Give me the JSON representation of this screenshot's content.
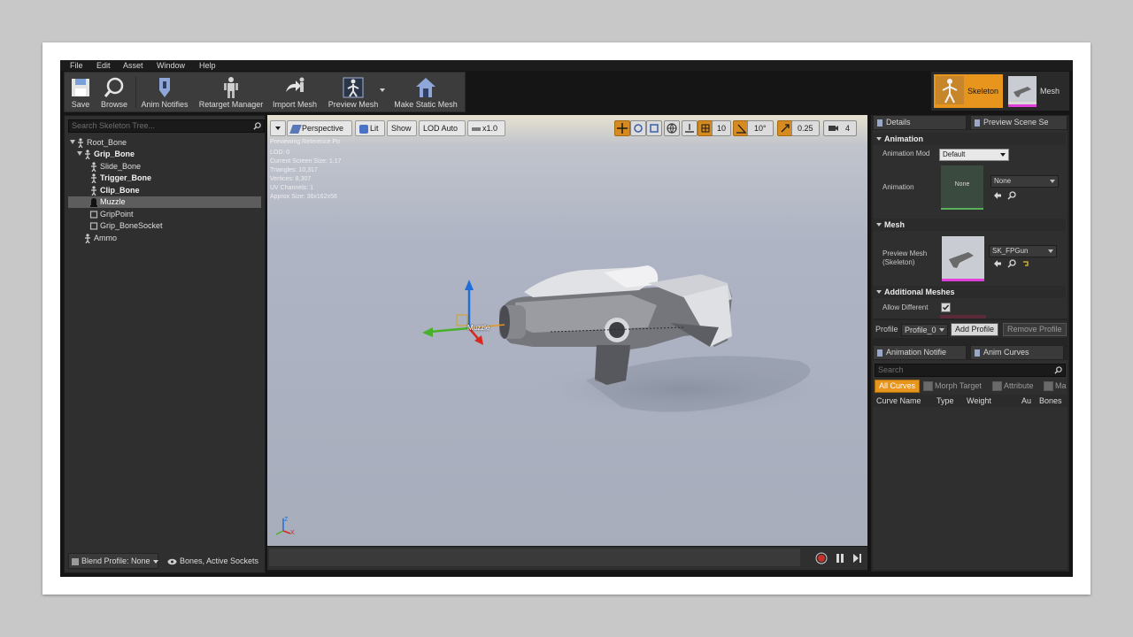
{
  "menu": [
    "File",
    "Edit",
    "Asset",
    "Window",
    "Help"
  ],
  "toolbar": [
    {
      "label": "Save",
      "icon": "save-icon"
    },
    {
      "label": "Browse",
      "icon": "magnifier-icon"
    },
    {
      "label": "Anim Notifies",
      "icon": "anim-notifies-icon"
    },
    {
      "label": "Retarget Manager",
      "icon": "retarget-manager-icon"
    },
    {
      "label": "Import Mesh",
      "icon": "import-mesh-icon"
    },
    {
      "label": "Preview Mesh",
      "icon": "preview-mesh-icon"
    },
    {
      "label": "Make Static Mesh",
      "icon": "make-static-mesh-icon"
    }
  ],
  "modes": [
    {
      "label": "Skeleton",
      "active": true
    },
    {
      "label": "Mesh",
      "active": false
    }
  ],
  "skeleton_tree": {
    "search_placeholder": "Search Skeleton Tree...",
    "items": [
      {
        "label": "Root_Bone",
        "bold": false,
        "selected": false
      },
      {
        "label": "Grip_Bone",
        "bold": true,
        "selected": false
      },
      {
        "label": "Slide_Bone",
        "bold": false,
        "selected": false
      },
      {
        "label": "Trigger_Bone",
        "bold": true,
        "selected": false
      },
      {
        "label": "Clip_Bone",
        "bold": true,
        "selected": false
      },
      {
        "label": "Muzzle",
        "bold": false,
        "selected": true
      },
      {
        "label": "GripPoint",
        "bold": false,
        "selected": false
      },
      {
        "label": "Grip_BoneSocket",
        "bold": false,
        "selected": false
      },
      {
        "label": "Ammo",
        "bold": false,
        "selected": false
      }
    ],
    "blend_profile": "Blend Profile: None",
    "bones_filter": "Bones, Active Sockets"
  },
  "viewport": {
    "perspective": "Perspective",
    "lit": "Lit",
    "show": "Show",
    "lod": "LOD Auto",
    "speed": "x1.0",
    "grid_snap": "10",
    "rotation_snap": "10°",
    "scale_snap": "0.25",
    "camera_speed": "4",
    "overlay": {
      "previewing": "Previewing Reference Po",
      "lod": "LOD: 0",
      "screen_size": "Current Screen Size: 1.17",
      "triangles": "Triangles: 10,317",
      "vertices": "Vertices: 8,307",
      "uv_channels": "UV Channels: 1",
      "approx_size": "Approx Size: 36x162x58"
    },
    "socket_label": "Muzzle",
    "axes": {
      "z": "Z",
      "x": "X"
    }
  },
  "details": {
    "tab_label": "Details",
    "preview_tab_label": "Preview Scene Se",
    "animation_header": "Animation",
    "animation_mode_label": "Animation Mod",
    "animation_mode_value": "Default",
    "animation_label": "Animation",
    "animation_thumb_text": "None",
    "animation_value": "None",
    "mesh_header": "Mesh",
    "preview_mesh_label": "Preview Mesh (Skeleton)",
    "preview_mesh_value": "SK_FPGun",
    "additional_header": "Additional Meshes",
    "allow_different_label": "Allow Different",
    "profile_label": "Profile",
    "profile_value": "Profile_0",
    "add_profile": "Add Profile",
    "remove_profile": "Remove Profile"
  },
  "curves": {
    "tab_notifies": "Animation Notifie",
    "tab_curves": "Anim Curves",
    "search_placeholder": "Search",
    "all_curves": "All Curves",
    "morph_target": "Morph Target",
    "attribute": "Attribute",
    "material": "Ma",
    "columns": [
      "Curve Name",
      "Type",
      "Weight",
      "Au",
      "Bones"
    ]
  },
  "colors": {
    "accent_orange": "#e8951e",
    "selection_gray": "#5d5d5d",
    "viewport_bg": "#a8afc0",
    "panel_bg": "#2f2f2f"
  }
}
